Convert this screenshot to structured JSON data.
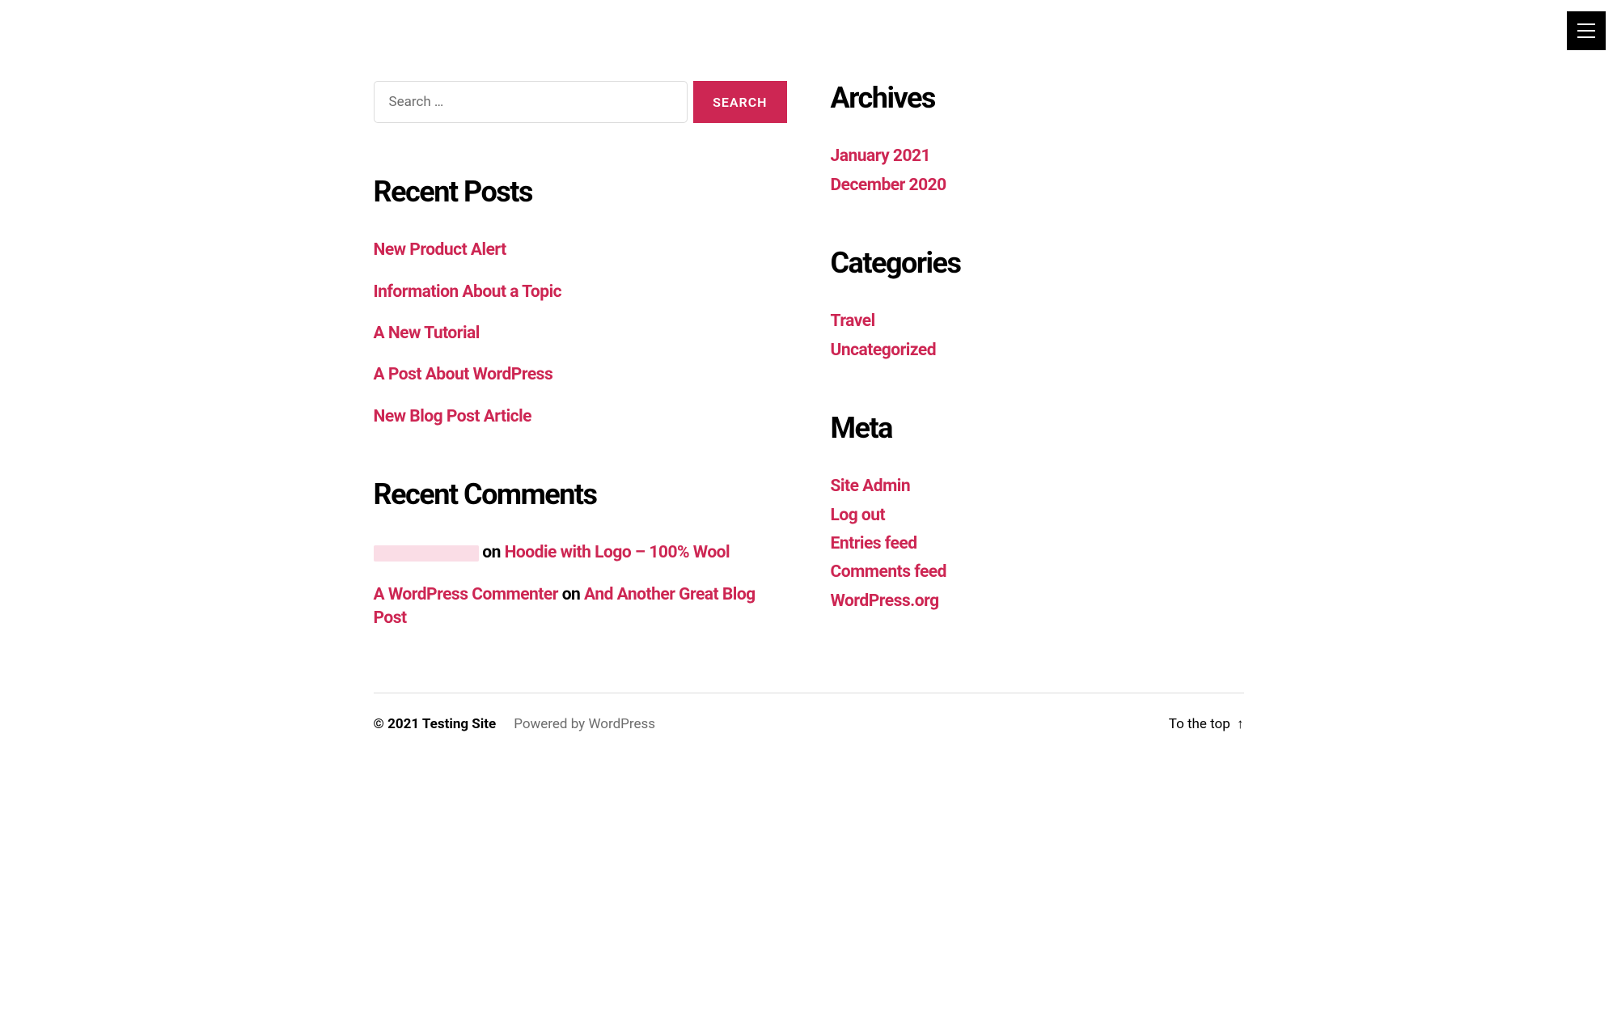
{
  "menu": {
    "label": "Menu"
  },
  "search": {
    "placeholder": "Search …",
    "button": "SEARCH"
  },
  "left": {
    "recentPosts": {
      "title": "Recent Posts",
      "items": [
        "New Product Alert",
        "Information About a Topic",
        "A New Tutorial",
        "A Post About WordPress",
        "New Blog Post Article"
      ]
    },
    "recentComments": {
      "title": "Recent Comments",
      "onText": "on",
      "items": [
        {
          "authorRedacted": true,
          "author": "",
          "post": "Hoodie with Logo – 100% Wool"
        },
        {
          "authorRedacted": false,
          "author": "A WordPress Commenter",
          "post": "And Another Great Blog Post"
        }
      ]
    }
  },
  "right": {
    "archives": {
      "title": "Archives",
      "items": [
        "January 2021",
        "December 2020"
      ]
    },
    "categories": {
      "title": "Categories",
      "items": [
        "Travel",
        "Uncategorized"
      ]
    },
    "meta": {
      "title": "Meta",
      "items": [
        "Site Admin",
        "Log out",
        "Entries feed",
        "Comments feed",
        "WordPress.org"
      ]
    }
  },
  "footer": {
    "copyrightPrefix": "© 2021 ",
    "siteName": "Testing Site",
    "poweredBy": "Powered by WordPress",
    "toTheTop": "To the top",
    "arrow": "↑"
  }
}
